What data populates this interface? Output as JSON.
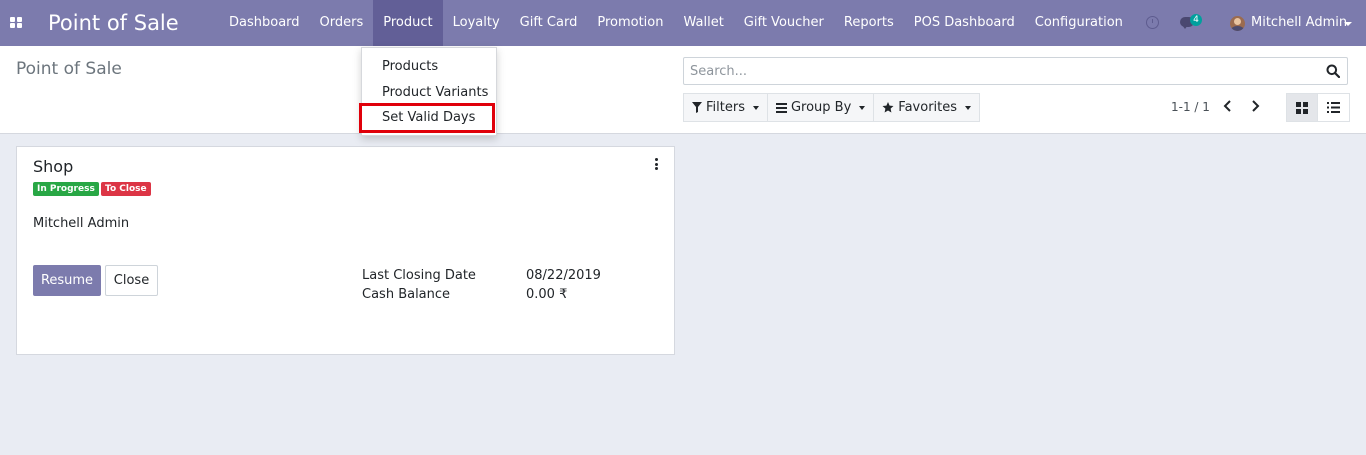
{
  "navbar": {
    "app_title": "Point of Sale",
    "menu": [
      "Dashboard",
      "Orders",
      "Product",
      "Loyalty",
      "Gift Card",
      "Promotion",
      "Wallet",
      "Gift Voucher",
      "Reports",
      "POS Dashboard",
      "Configuration"
    ],
    "active_menu": "Product",
    "chat_count": "4",
    "user_name": "Mitchell Admin"
  },
  "dropdown": {
    "items": [
      "Products",
      "Product Variants",
      "Set Valid Days"
    ],
    "highlighted_item": "Set Valid Days"
  },
  "control_panel": {
    "breadcrumb": "Point of Sale",
    "search_placeholder": "Search...",
    "filters_label": "Filters",
    "group_by_label": "Group By",
    "favorites_label": "Favorites",
    "pager_value": "1-1 / 1"
  },
  "card": {
    "title": "Shop",
    "badges": [
      "In Progress",
      "To Close"
    ],
    "responsible": "Mitchell Admin",
    "resume_label": "Resume",
    "close_label": "Close",
    "last_closing_date_label": "Last Closing Date",
    "last_closing_date_value": "08/22/2019",
    "cash_balance_label": "Cash Balance",
    "cash_balance_value": "0.00 ₹"
  },
  "colors": {
    "navbar": "#7c7bad",
    "navbar_active": "#625f97",
    "badge_in_progress": "#28a745",
    "badge_to_close": "#dc3545",
    "highlight_box": "#e0000a"
  },
  "icons": [
    "apps-icon",
    "clock-icon",
    "chat-icon",
    "avatar",
    "search-icon",
    "filter-icon",
    "group-by-icon",
    "star-icon",
    "chevron-left-icon",
    "chevron-right-icon",
    "kanban-view-icon",
    "list-view-icon",
    "kebab-menu-icon"
  ]
}
